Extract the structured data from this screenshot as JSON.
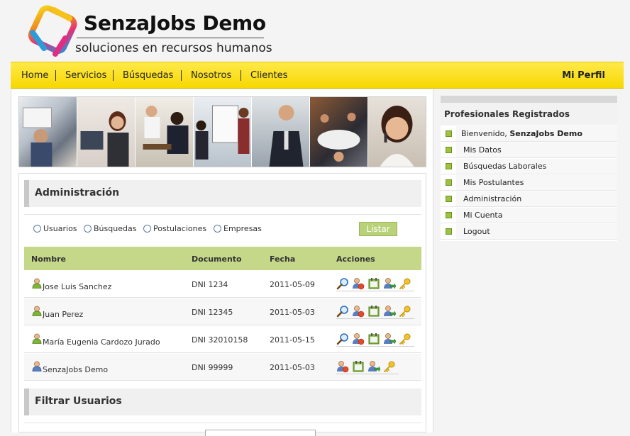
{
  "brand": {
    "title": "SenzaJobs Demo",
    "subtitle": "soluciones en recursos humanos"
  },
  "nav": {
    "items": [
      "Home",
      "Servicios",
      "Búsquedas",
      "Nosotros",
      "Clientes"
    ],
    "profile": "Mi Perfil",
    "bg_color": "#f7d800"
  },
  "admin": {
    "title": "Administración",
    "filters": [
      "Usuarios",
      "Búsquedas",
      "Postulaciones",
      "Empresas"
    ],
    "list_button": "Listar",
    "columns": [
      "Nombre",
      "Documento",
      "Fecha",
      "Acciones"
    ],
    "rows": [
      {
        "name": "Jose Luis Sanchez",
        "document": "DNI 1234",
        "date": "2011-05-09",
        "actions": [
          "view-icon",
          "user-edit-icon",
          "calendar-icon",
          "user-arrow-icon",
          "key-icon"
        ]
      },
      {
        "name": "Juan Perez",
        "document": "DNI 12345",
        "date": "2011-05-03",
        "actions": [
          "view-icon",
          "user-edit-icon",
          "calendar-icon",
          "user-arrow-icon",
          "key-icon"
        ]
      },
      {
        "name": "María Eugenia Cardozo Jurado",
        "document": "DNI 32010158",
        "date": "2011-05-15",
        "actions": [
          "view-icon",
          "user-edit-icon",
          "calendar-icon",
          "user-arrow-icon",
          "key-icon"
        ]
      },
      {
        "name": "SenzaJobs Demo",
        "document": "DNI 99999",
        "date": "2011-05-03",
        "actions": [
          "user-edit-icon",
          "calendar-icon",
          "user-arrow-icon",
          "key-icon"
        ]
      }
    ],
    "header_color": "#c5d88a"
  },
  "filter_users": {
    "title": "Filtrar Usuarios"
  },
  "sidebar": {
    "title": "Profesionales Registrados",
    "welcome_prefix": "Bienvenido, ",
    "welcome_name": "SenzaJobs Demo",
    "items": [
      "Mis Datos",
      "Búsquedas Laborales",
      "Mis Postulantes",
      "Administración",
      "Mi Cuenta",
      "Logout"
    ]
  }
}
